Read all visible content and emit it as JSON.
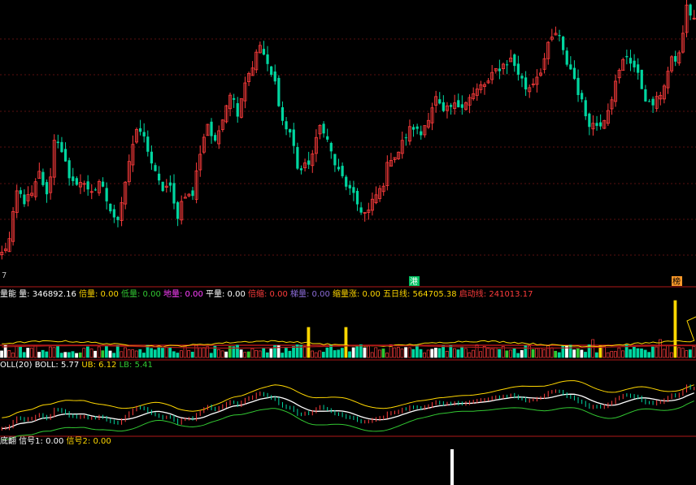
{
  "colors": {
    "background": "#000000",
    "up": "#ff3c3c",
    "down": "#00d6a0",
    "grid": "#5a1010",
    "separator": "#b01818",
    "white": "#ffffff",
    "yellow": "#ffd700",
    "green": "#32c832",
    "magenta": "#ff40ff",
    "purple": "#8c6cd8",
    "orange": "#ff9a2a",
    "ticker_green": "#00c060"
  },
  "price_panel": {
    "axis_tick_label": "7",
    "marker_left": "港",
    "marker_right": "榜"
  },
  "volume_panel": {
    "items": [
      {
        "text": "量能",
        "color": "#ffffff"
      },
      {
        "text": "量: 346892.16",
        "color": "#ffffff"
      },
      {
        "text": "倍量: 0.00",
        "color": "#ffd700"
      },
      {
        "text": "低量: 0.00",
        "color": "#32c832"
      },
      {
        "text": "地量: 0.00",
        "color": "#ff40ff"
      },
      {
        "text": "平量: 0.00",
        "color": "#ffffff"
      },
      {
        "text": "倍缩: 0.00",
        "color": "#ff3c3c"
      },
      {
        "text": "梯量: 0.00",
        "color": "#8c6cd8"
      },
      {
        "text": "缩量涨: 0.00",
        "color": "#ffd700"
      },
      {
        "text": "五日线: 564705.38",
        "color": "#ffd700"
      },
      {
        "text": "启动线: 241013.17",
        "color": "#ff3c3c"
      }
    ]
  },
  "boll_panel": {
    "items": [
      {
        "text": "OLL(20)",
        "color": "#ffffff"
      },
      {
        "text": "BOLL: 5.77",
        "color": "#ffffff"
      },
      {
        "text": "UB: 6.12",
        "color": "#ffd700"
      },
      {
        "text": "LB: 5.41",
        "color": "#32c832"
      }
    ]
  },
  "signal_panel": {
    "items": [
      {
        "text": "底翻",
        "color": "#ffffff"
      },
      {
        "text": "信号1: 0.00",
        "color": "#ffffff"
      },
      {
        "text": "信号2: 0.00",
        "color": "#ffd700"
      }
    ]
  },
  "chart_data": [
    {
      "type": "candlestick",
      "title": "",
      "close_path": [
        [
          0,
          0.04
        ],
        [
          8,
          0.095
        ],
        [
          16,
          0.285
        ],
        [
          20,
          0.245
        ],
        [
          28,
          0.27
        ],
        [
          40,
          0.36
        ],
        [
          50,
          0.25
        ],
        [
          53,
          0.51
        ],
        [
          55,
          0.44
        ],
        [
          64,
          0.3
        ],
        [
          70,
          0.33
        ],
        [
          66,
          0.3
        ],
        [
          54,
          0.29
        ],
        [
          48,
          0.31
        ],
        [
          52,
          0.23
        ],
        [
          42,
          0.15
        ],
        [
          50,
          0.29
        ],
        [
          54,
          0.45
        ],
        [
          64,
          0.53
        ],
        [
          60,
          0.47
        ],
        [
          55,
          0.36
        ],
        [
          48,
          0.29
        ],
        [
          44,
          0.31
        ],
        [
          36,
          0.18
        ],
        [
          46,
          0.28
        ],
        [
          42,
          0.255
        ],
        [
          55,
          0.43
        ],
        [
          61,
          0.555
        ],
        [
          66,
          0.46
        ],
        [
          70,
          0.58
        ],
        [
          72,
          0.675
        ],
        [
          74,
          0.595
        ],
        [
          80,
          0.72
        ],
        [
          76,
          0.78
        ],
        [
          84,
          0.86
        ],
        [
          68,
          0.76
        ],
        [
          62,
          0.7
        ],
        [
          55,
          0.54
        ],
        [
          46,
          0.51
        ],
        [
          42,
          0.36
        ],
        [
          46,
          0.38
        ],
        [
          53,
          0.44
        ],
        [
          60,
          0.56
        ],
        [
          55,
          0.46
        ],
        [
          47,
          0.37
        ],
        [
          45,
          0.325
        ],
        [
          35,
          0.27
        ],
        [
          28,
          0.22
        ],
        [
          30,
          0.19
        ],
        [
          36,
          0.26
        ],
        [
          34,
          0.3
        ],
        [
          45,
          0.42
        ],
        [
          50,
          0.43
        ],
        [
          52,
          0.495
        ],
        [
          56,
          0.54
        ],
        [
          54,
          0.5
        ],
        [
          58,
          0.575
        ],
        [
          60,
          0.65
        ],
        [
          56,
          0.585
        ],
        [
          57,
          0.61
        ],
        [
          60,
          0.62
        ],
        [
          63,
          0.64
        ],
        [
          65,
          0.66
        ],
        [
          63,
          0.695
        ],
        [
          66,
          0.71
        ],
        [
          72,
          0.76
        ],
        [
          76,
          0.78
        ],
        [
          79,
          0.8
        ],
        [
          75,
          0.74
        ],
        [
          70,
          0.68
        ],
        [
          72,
          0.72
        ],
        [
          75,
          0.77
        ],
        [
          73,
          0.865
        ],
        [
          78,
          0.91
        ],
        [
          70,
          0.8
        ],
        [
          68,
          0.75
        ],
        [
          62,
          0.65
        ],
        [
          54,
          0.56
        ],
        [
          58,
          0.54
        ],
        [
          64,
          0.56
        ],
        [
          70,
          0.64
        ],
        [
          77,
          0.735
        ],
        [
          75,
          0.82
        ],
        [
          64,
          0.78
        ],
        [
          55,
          0.7
        ],
        [
          48,
          0.62
        ],
        [
          58,
          0.63
        ],
        [
          55,
          0.7
        ],
        [
          60,
          0.79
        ],
        [
          66,
          0.81
        ],
        [
          86,
          1.0
        ],
        [
          95,
          0.96
        ]
      ],
      "candle_count": 186
    },
    {
      "type": "bar",
      "name": "volume",
      "values_relative": [],
      "candle_count": 186
    },
    {
      "type": "line",
      "name": "boll",
      "series": [
        {
          "name": "BOLL",
          "values": [
            5.77
          ]
        },
        {
          "name": "UB",
          "values": [
            6.12
          ]
        },
        {
          "name": "LB",
          "values": [
            5.41
          ]
        }
      ]
    },
    {
      "type": "bar",
      "name": "signal",
      "series": [
        {
          "name": "信号1",
          "values": [
            0.0
          ]
        },
        {
          "name": "信号2",
          "values": [
            0.0
          ]
        }
      ]
    }
  ]
}
